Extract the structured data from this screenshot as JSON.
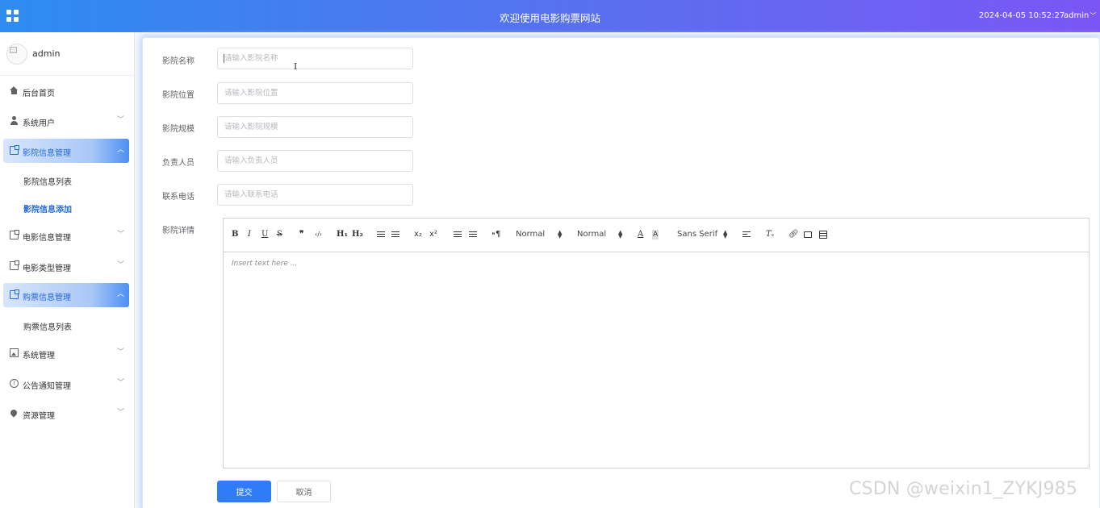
{
  "header": {
    "title": "欢迎使用电影购票网站",
    "datetime": "2024-04-05 10:52:27",
    "user": "admin"
  },
  "sidebar": {
    "username": "admin",
    "items": [
      {
        "label": "后台首页",
        "icon": "home-icon"
      },
      {
        "label": "系统用户",
        "icon": "user-icon"
      },
      {
        "label": "影院信息管理",
        "icon": "document-icon",
        "sub": [
          "影院信息列表",
          "影院信息添加"
        ]
      },
      {
        "label": "电影信息管理",
        "icon": "document-icon"
      },
      {
        "label": "电影类型管理",
        "icon": "document-icon"
      },
      {
        "label": "购票信息管理",
        "icon": "document-icon",
        "sub": [
          "购票信息列表"
        ]
      },
      {
        "label": "系统管理",
        "icon": "picture-icon"
      },
      {
        "label": "公告通知管理",
        "icon": "info-icon"
      },
      {
        "label": "资源管理",
        "icon": "location-icon"
      }
    ]
  },
  "form": {
    "fields": [
      {
        "label": "影院名称",
        "placeholder": "请输入影院名称",
        "value": ""
      },
      {
        "label": "影院位置",
        "placeholder": "请输入影院位置",
        "value": ""
      },
      {
        "label": "影院规模",
        "placeholder": "请输入影院规模",
        "value": ""
      },
      {
        "label": "负责人员",
        "placeholder": "请输入负责人员",
        "value": ""
      },
      {
        "label": "联系电话",
        "placeholder": "请输入联系电话",
        "value": ""
      }
    ],
    "details_label": "影院详情",
    "submit_label": "提交",
    "cancel_label": "取消"
  },
  "editor": {
    "toolbar": {
      "bold": "B",
      "italic": "I",
      "underline": "U",
      "strike": "S",
      "quote": "❞",
      "code": "‹/›",
      "h1": "H₁",
      "h2": "H₂",
      "sub": "x₂",
      "sup": "x²",
      "direction": "⁍¶",
      "size_select": "Normal",
      "header_select": "Normal",
      "color": "A",
      "background": "A",
      "font_select": "Sans Serif",
      "clean": "Tₓ"
    },
    "placeholder": "Insert text here ..."
  },
  "watermark": "CSDN @weixin1_ZYKJ985",
  "colors": {
    "accent": "#2f7cf6",
    "header_start": "#2d8cf0",
    "header_end": "#7b56f5"
  }
}
